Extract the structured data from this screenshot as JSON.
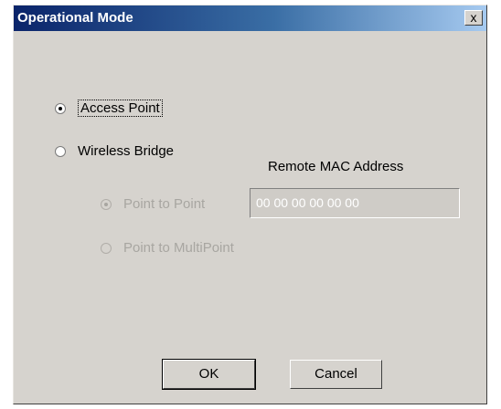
{
  "window": {
    "title": "Operational Mode",
    "close_label": "x"
  },
  "mode": {
    "access_point_label": "Access Point",
    "wireless_bridge_label": "Wireless Bridge",
    "selected": "access_point"
  },
  "bridge": {
    "remote_mac_label": "Remote MAC Address",
    "mac_value": "00 00 00 00 00 00",
    "point_to_point_label": "Point to Point",
    "point_to_multipoint_label": "Point to MultiPoint",
    "selected": "point_to_point",
    "enabled": false
  },
  "buttons": {
    "ok_label": "OK",
    "cancel_label": "Cancel"
  }
}
